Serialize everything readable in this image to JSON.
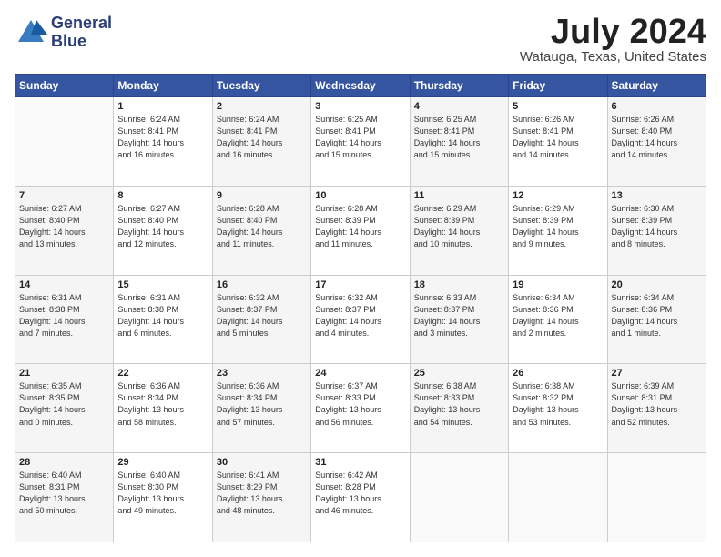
{
  "header": {
    "logo_line1": "General",
    "logo_line2": "Blue",
    "month_title": "July 2024",
    "location": "Watauga, Texas, United States"
  },
  "days_of_week": [
    "Sunday",
    "Monday",
    "Tuesday",
    "Wednesday",
    "Thursday",
    "Friday",
    "Saturday"
  ],
  "weeks": [
    [
      {
        "num": "",
        "info": ""
      },
      {
        "num": "1",
        "info": "Sunrise: 6:24 AM\nSunset: 8:41 PM\nDaylight: 14 hours\nand 16 minutes."
      },
      {
        "num": "2",
        "info": "Sunrise: 6:24 AM\nSunset: 8:41 PM\nDaylight: 14 hours\nand 16 minutes."
      },
      {
        "num": "3",
        "info": "Sunrise: 6:25 AM\nSunset: 8:41 PM\nDaylight: 14 hours\nand 15 minutes."
      },
      {
        "num": "4",
        "info": "Sunrise: 6:25 AM\nSunset: 8:41 PM\nDaylight: 14 hours\nand 15 minutes."
      },
      {
        "num": "5",
        "info": "Sunrise: 6:26 AM\nSunset: 8:41 PM\nDaylight: 14 hours\nand 14 minutes."
      },
      {
        "num": "6",
        "info": "Sunrise: 6:26 AM\nSunset: 8:40 PM\nDaylight: 14 hours\nand 14 minutes."
      }
    ],
    [
      {
        "num": "7",
        "info": "Sunrise: 6:27 AM\nSunset: 8:40 PM\nDaylight: 14 hours\nand 13 minutes."
      },
      {
        "num": "8",
        "info": "Sunrise: 6:27 AM\nSunset: 8:40 PM\nDaylight: 14 hours\nand 12 minutes."
      },
      {
        "num": "9",
        "info": "Sunrise: 6:28 AM\nSunset: 8:40 PM\nDaylight: 14 hours\nand 11 minutes."
      },
      {
        "num": "10",
        "info": "Sunrise: 6:28 AM\nSunset: 8:39 PM\nDaylight: 14 hours\nand 11 minutes."
      },
      {
        "num": "11",
        "info": "Sunrise: 6:29 AM\nSunset: 8:39 PM\nDaylight: 14 hours\nand 10 minutes."
      },
      {
        "num": "12",
        "info": "Sunrise: 6:29 AM\nSunset: 8:39 PM\nDaylight: 14 hours\nand 9 minutes."
      },
      {
        "num": "13",
        "info": "Sunrise: 6:30 AM\nSunset: 8:39 PM\nDaylight: 14 hours\nand 8 minutes."
      }
    ],
    [
      {
        "num": "14",
        "info": "Sunrise: 6:31 AM\nSunset: 8:38 PM\nDaylight: 14 hours\nand 7 minutes."
      },
      {
        "num": "15",
        "info": "Sunrise: 6:31 AM\nSunset: 8:38 PM\nDaylight: 14 hours\nand 6 minutes."
      },
      {
        "num": "16",
        "info": "Sunrise: 6:32 AM\nSunset: 8:37 PM\nDaylight: 14 hours\nand 5 minutes."
      },
      {
        "num": "17",
        "info": "Sunrise: 6:32 AM\nSunset: 8:37 PM\nDaylight: 14 hours\nand 4 minutes."
      },
      {
        "num": "18",
        "info": "Sunrise: 6:33 AM\nSunset: 8:37 PM\nDaylight: 14 hours\nand 3 minutes."
      },
      {
        "num": "19",
        "info": "Sunrise: 6:34 AM\nSunset: 8:36 PM\nDaylight: 14 hours\nand 2 minutes."
      },
      {
        "num": "20",
        "info": "Sunrise: 6:34 AM\nSunset: 8:36 PM\nDaylight: 14 hours\nand 1 minute."
      }
    ],
    [
      {
        "num": "21",
        "info": "Sunrise: 6:35 AM\nSunset: 8:35 PM\nDaylight: 14 hours\nand 0 minutes."
      },
      {
        "num": "22",
        "info": "Sunrise: 6:36 AM\nSunset: 8:34 PM\nDaylight: 13 hours\nand 58 minutes."
      },
      {
        "num": "23",
        "info": "Sunrise: 6:36 AM\nSunset: 8:34 PM\nDaylight: 13 hours\nand 57 minutes."
      },
      {
        "num": "24",
        "info": "Sunrise: 6:37 AM\nSunset: 8:33 PM\nDaylight: 13 hours\nand 56 minutes."
      },
      {
        "num": "25",
        "info": "Sunrise: 6:38 AM\nSunset: 8:33 PM\nDaylight: 13 hours\nand 54 minutes."
      },
      {
        "num": "26",
        "info": "Sunrise: 6:38 AM\nSunset: 8:32 PM\nDaylight: 13 hours\nand 53 minutes."
      },
      {
        "num": "27",
        "info": "Sunrise: 6:39 AM\nSunset: 8:31 PM\nDaylight: 13 hours\nand 52 minutes."
      }
    ],
    [
      {
        "num": "28",
        "info": "Sunrise: 6:40 AM\nSunset: 8:31 PM\nDaylight: 13 hours\nand 50 minutes."
      },
      {
        "num": "29",
        "info": "Sunrise: 6:40 AM\nSunset: 8:30 PM\nDaylight: 13 hours\nand 49 minutes."
      },
      {
        "num": "30",
        "info": "Sunrise: 6:41 AM\nSunset: 8:29 PM\nDaylight: 13 hours\nand 48 minutes."
      },
      {
        "num": "31",
        "info": "Sunrise: 6:42 AM\nSunset: 8:28 PM\nDaylight: 13 hours\nand 46 minutes."
      },
      {
        "num": "",
        "info": ""
      },
      {
        "num": "",
        "info": ""
      },
      {
        "num": "",
        "info": ""
      }
    ]
  ]
}
